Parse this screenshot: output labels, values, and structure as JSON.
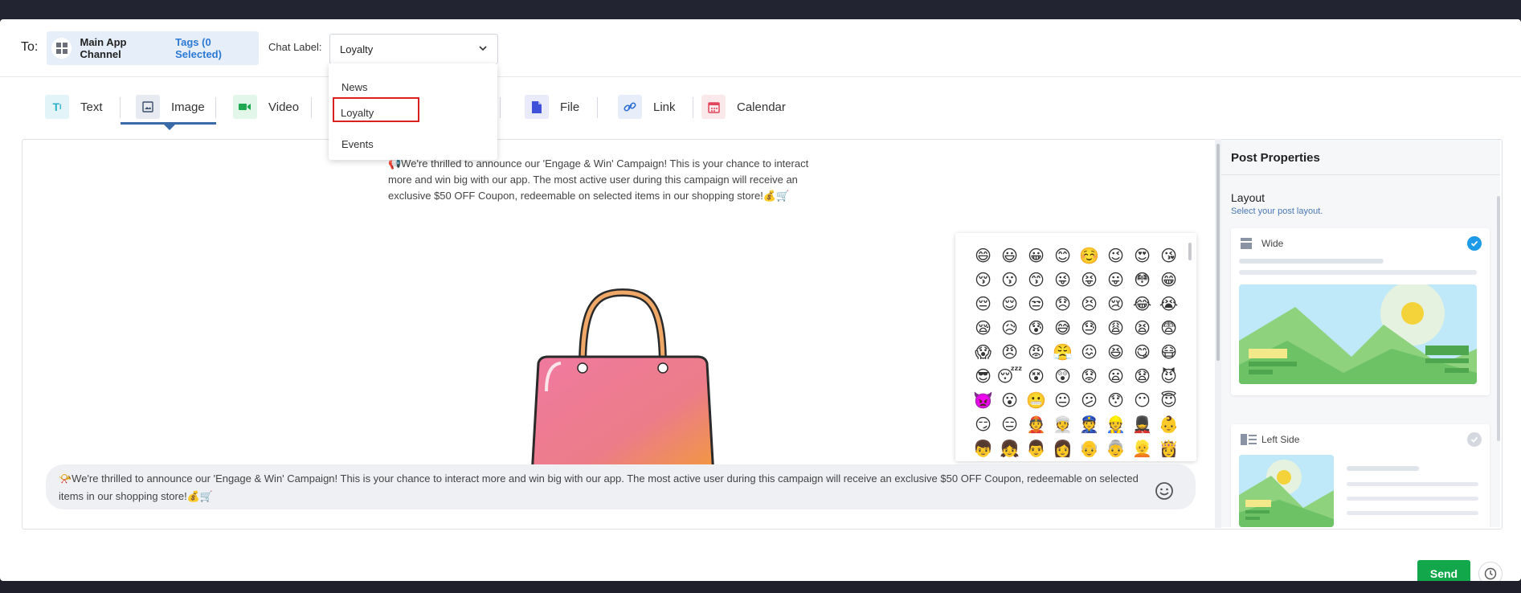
{
  "header": {
    "to_label": "To:",
    "channel_name": "Main App Channel",
    "tags_link": "Tags (0 Selected)",
    "chat_label_text": "Chat Label:",
    "chat_label_selected": "Loyalty",
    "chat_label_options": [
      "News",
      "Loyalty",
      "Events"
    ]
  },
  "tabs": [
    {
      "label": "Text",
      "icon": "text-icon"
    },
    {
      "label": "Image",
      "icon": "image-icon",
      "active": true
    },
    {
      "label": "Video",
      "icon": "video-icon"
    },
    {
      "label": "File",
      "icon": "file-icon"
    },
    {
      "label": "Link",
      "icon": "link-icon"
    },
    {
      "label": "Calendar",
      "icon": "calendar-icon"
    }
  ],
  "preview": {
    "text": "📢We're thrilled to announce our 'Engage & Win' Campaign! This is your chance to interact more and win big with our app. The most active user during this campaign will receive an exclusive $50 OFF Coupon, redeemable on selected items in our shopping store!💰🛒"
  },
  "composer": {
    "text": "📯We're thrilled to announce our 'Engage & Win' Campaign! This is your chance to interact more and win big with our app. The most active user during this campaign will receive an exclusive $50 OFF Coupon, redeemable on selected items in our shopping store!💰🛒"
  },
  "emoji_picker": {
    "emojis": [
      "😄",
      "😃",
      "😀",
      "😊",
      "☺️",
      "😉",
      "😍",
      "😘",
      "😚",
      "😗",
      "😙",
      "😜",
      "😝",
      "😛",
      "😳",
      "😁",
      "😔",
      "😌",
      "😒",
      "😞",
      "😣",
      "😢",
      "😂",
      "😭",
      "😪",
      "😥",
      "😰",
      "😅",
      "😓",
      "😩",
      "😫",
      "😨",
      "😱",
      "😠",
      "😡",
      "😤",
      "😖",
      "😆",
      "😋",
      "😷",
      "😎",
      "😴",
      "😵",
      "😲",
      "😟",
      "😦",
      "😧",
      "😈",
      "👿",
      "😮",
      "😬",
      "😐",
      "😕",
      "😯",
      "😶",
      "😇",
      "😏",
      "😑",
      "👲",
      "👳",
      "👮",
      "👷",
      "💂",
      "👶",
      "👦",
      "👧",
      "👨",
      "👩",
      "👴",
      "👵",
      "👱",
      "👸"
    ]
  },
  "panel": {
    "title": "Post Properties",
    "layout_heading": "Layout",
    "layout_subtitle": "Select your post layout.",
    "options": [
      {
        "label": "Wide",
        "selected": true
      },
      {
        "label": "Left Side",
        "selected": false
      }
    ]
  },
  "footer": {
    "send_label": "Send"
  },
  "colors": {
    "accent_blue": "#2a79d4",
    "send_green": "#12a74a",
    "highlight_red": "#d9211f",
    "check_blue": "#1e9be8"
  }
}
